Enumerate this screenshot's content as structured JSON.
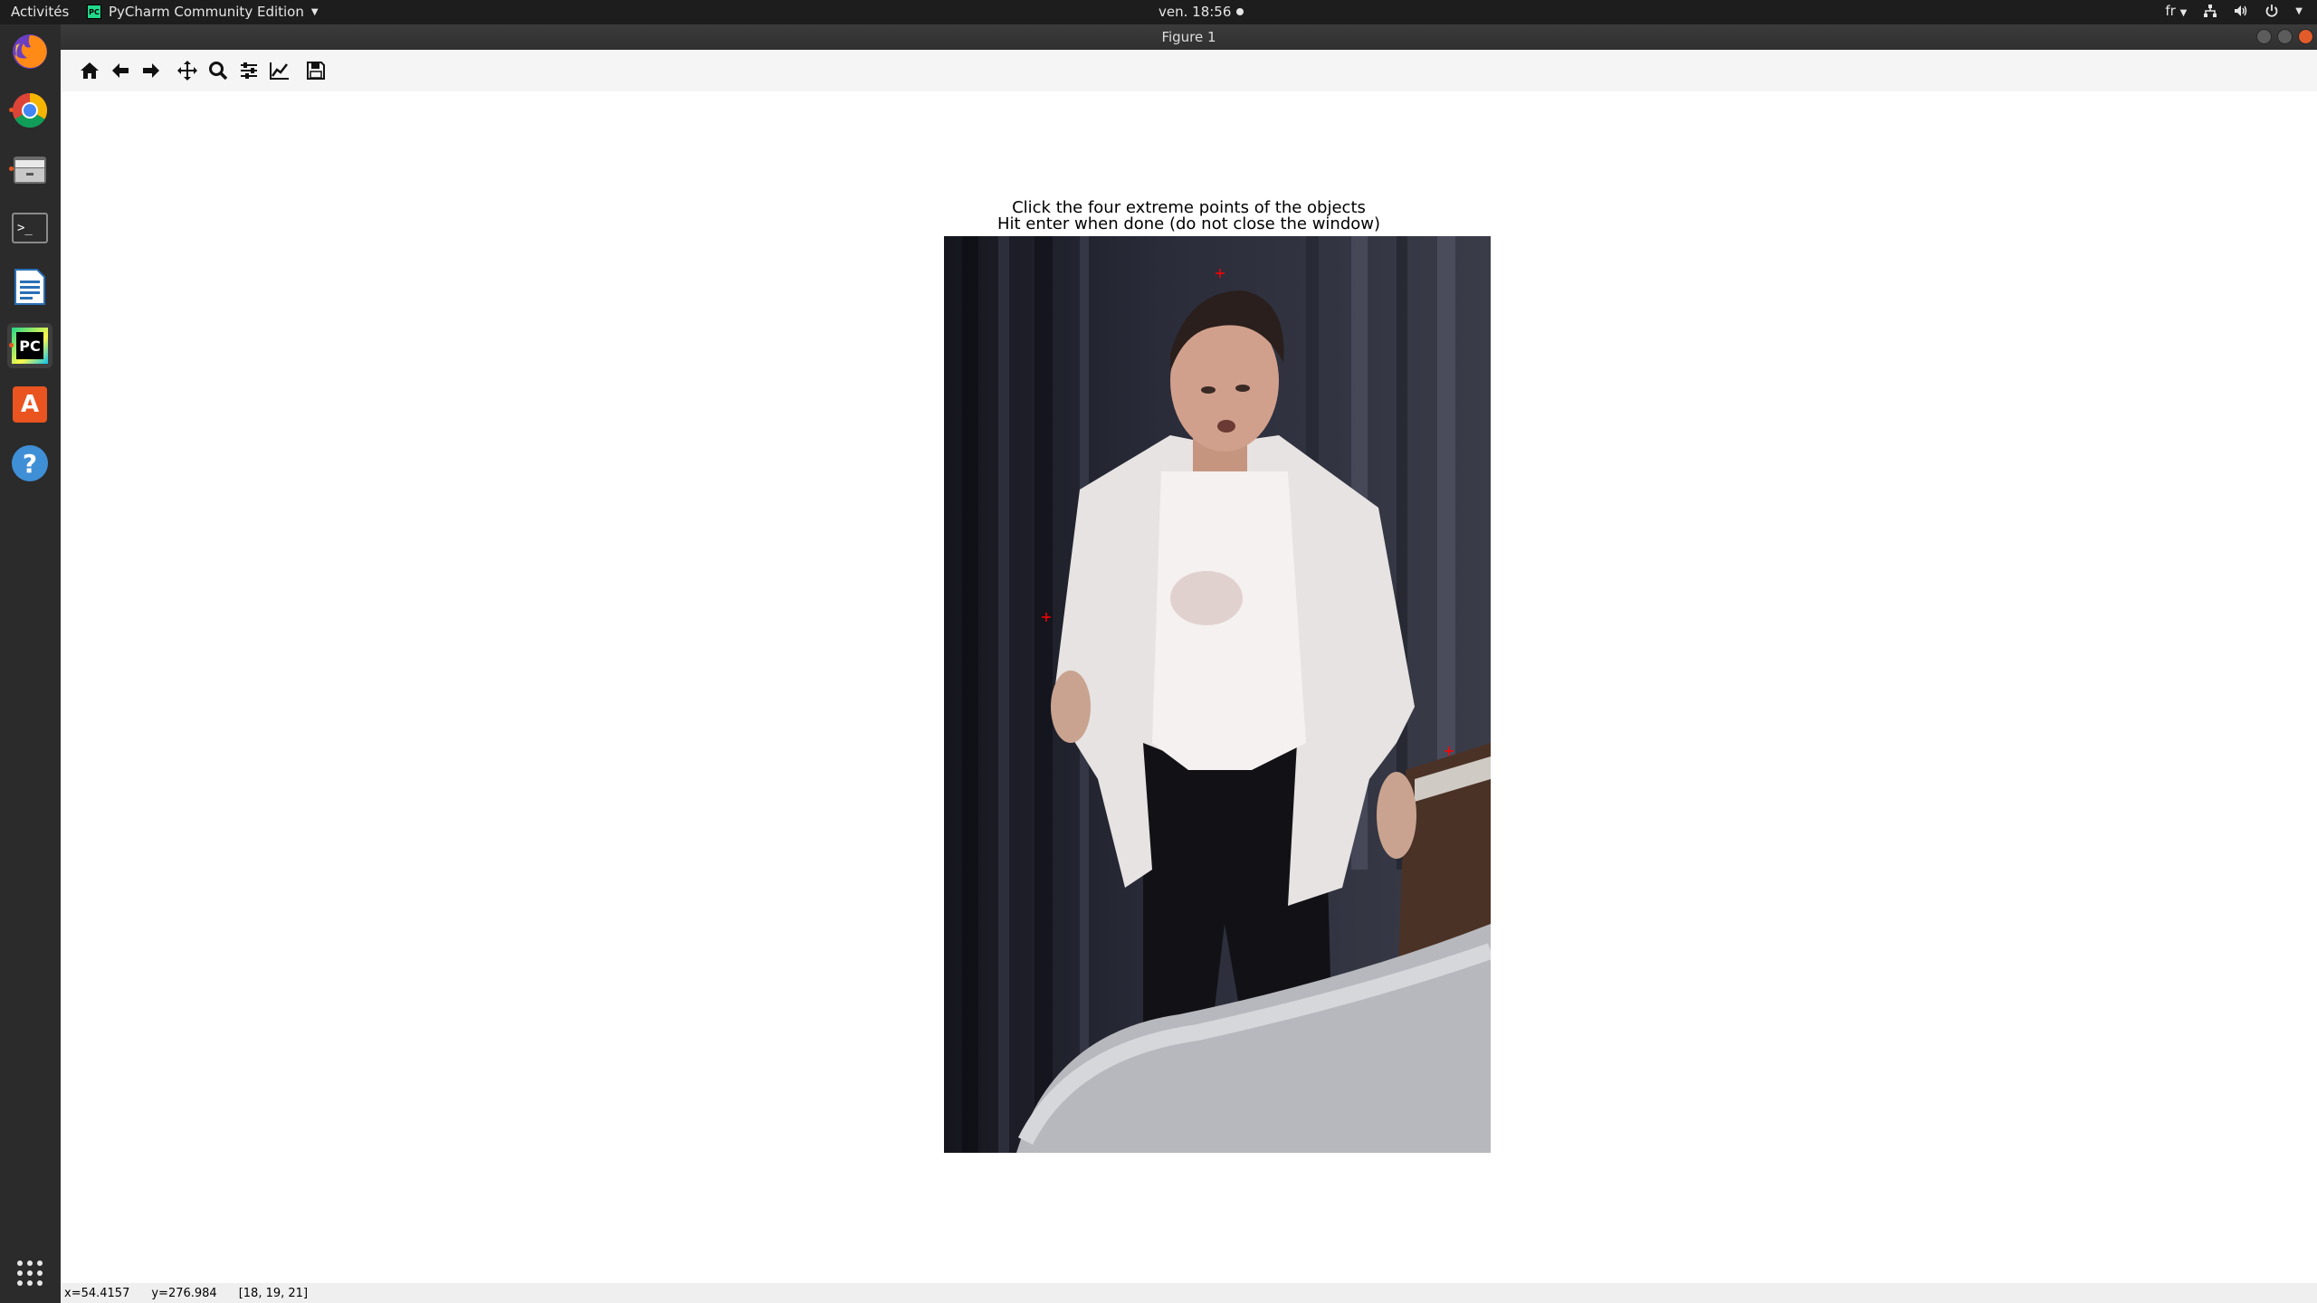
{
  "topbar": {
    "activities": "Activités",
    "app_menu": "PyCharm Community Edition",
    "app_icon_text": "PC",
    "clock": "ven. 18:56",
    "keyboard_layout": "fr",
    "icons": [
      "network-icon",
      "volume-icon",
      "power-icon",
      "chevron-down-icon"
    ]
  },
  "window": {
    "title": "Figure 1"
  },
  "dock": {
    "items": [
      "firefox-icon",
      "chrome-icon",
      "files-icon",
      "terminal-icon",
      "writer-icon",
      "pycharm-icon",
      "software-center-icon",
      "help-icon",
      "show-apps-icon"
    ],
    "pycharm_label": "PC",
    "software_center_label": "A",
    "help_label": "?",
    "terminal_label": ">_"
  },
  "toolbar": {
    "buttons": [
      "home-icon",
      "back-icon",
      "forward-icon",
      "pan-icon",
      "zoom-icon",
      "subplots-icon",
      "edit-axes-icon",
      "save-icon"
    ]
  },
  "figure": {
    "title_line1": "Click the four extreme points of the objects",
    "title_line2": "Hit enter when done (do not close the window)"
  },
  "status": {
    "x": "x=54.4157",
    "y": "y=276.984",
    "pixel": "[18, 19, 21]"
  },
  "colors": {
    "marker": "#ff0000",
    "topbar_bg": "#1d1d1d",
    "dock_bg": "#2b2b2b",
    "accent": "#e95420"
  }
}
